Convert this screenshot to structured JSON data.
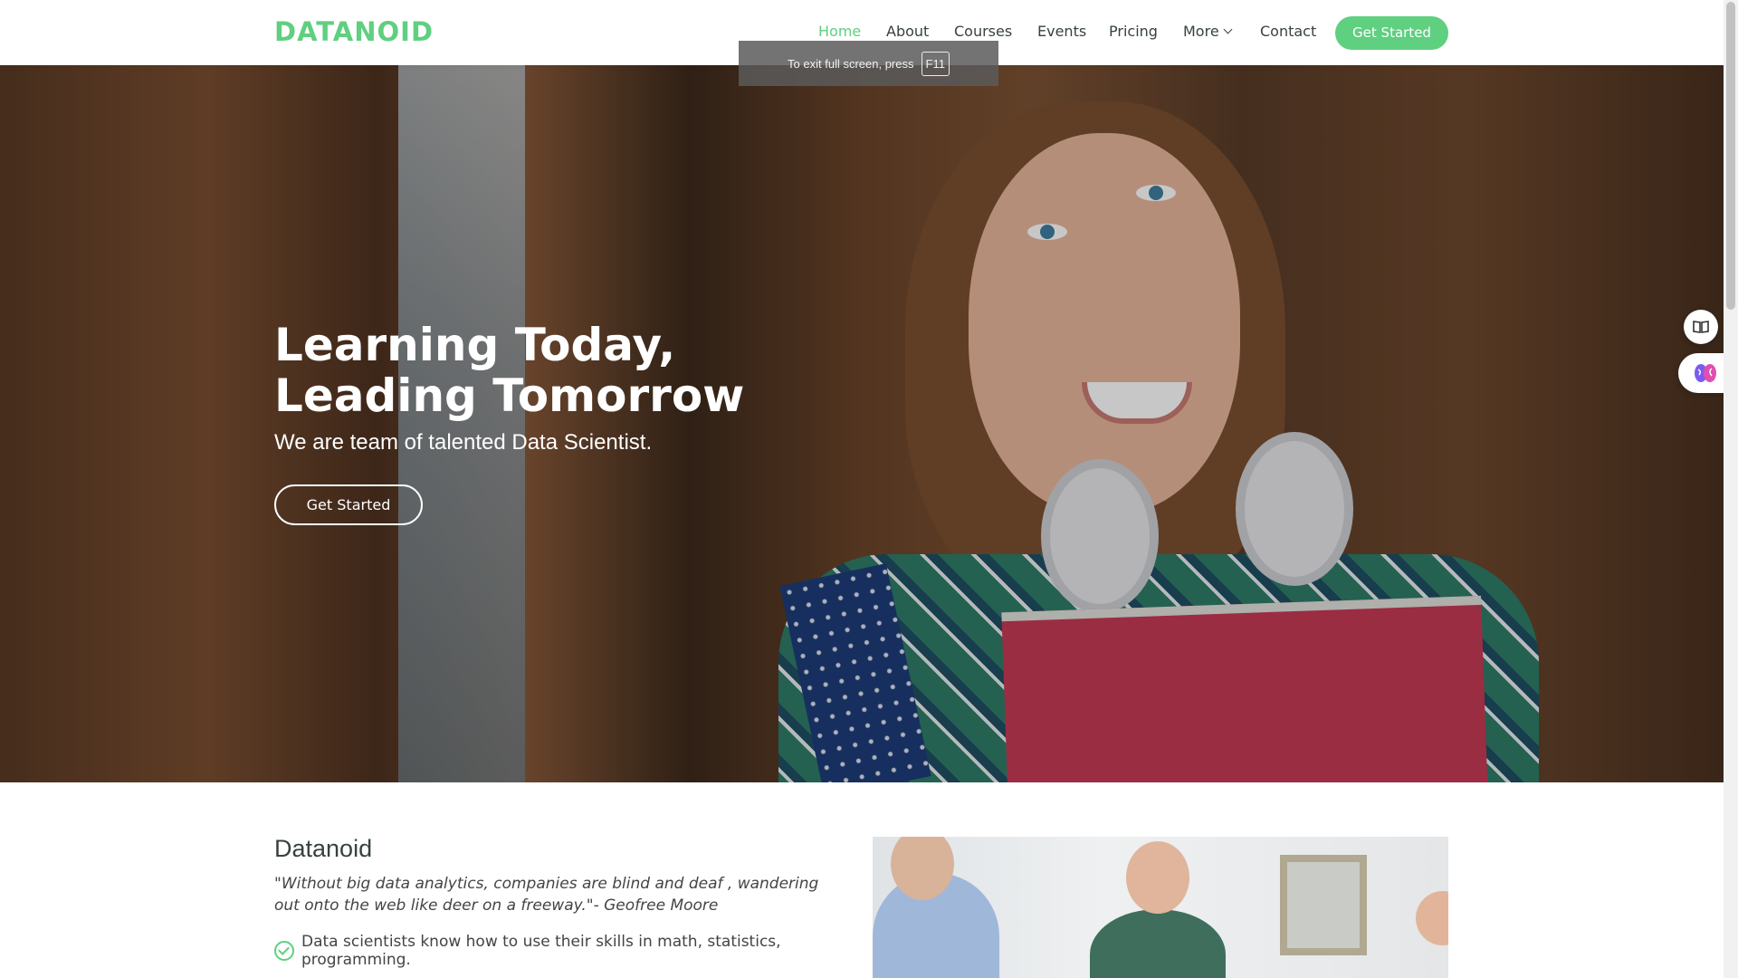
{
  "header": {
    "logo": "DATANOID",
    "nav": [
      {
        "label": "Home",
        "active": true
      },
      {
        "label": "About"
      },
      {
        "label": "Courses"
      },
      {
        "label": "Events"
      },
      {
        "label": "Pricing"
      },
      {
        "label": "More"
      },
      {
        "label": "Contact"
      }
    ],
    "cta_label": "Get Started"
  },
  "fullscreen_notice": {
    "text": "To exit full screen, press",
    "key": "F11"
  },
  "hero": {
    "title_line1": "Learning Today,",
    "title_line2": "Leading Tomorrow",
    "subtitle": "We are team of talented Data Scientist.",
    "button_label": "Get Started"
  },
  "side_widgets": [
    {
      "icon": "book-icon"
    },
    {
      "icon": "brain-icon"
    }
  ],
  "about": {
    "title": "Datanoid",
    "quote": "\"Without big data analytics, companies are blind and deaf , wandering out onto the web like deer on a freeway.\"- Geofree Moore",
    "items": [
      "Data scientists know how to use their skills in math, statistics, programming."
    ]
  },
  "colors": {
    "accent": "#5fcf80",
    "text": "#37423b"
  }
}
